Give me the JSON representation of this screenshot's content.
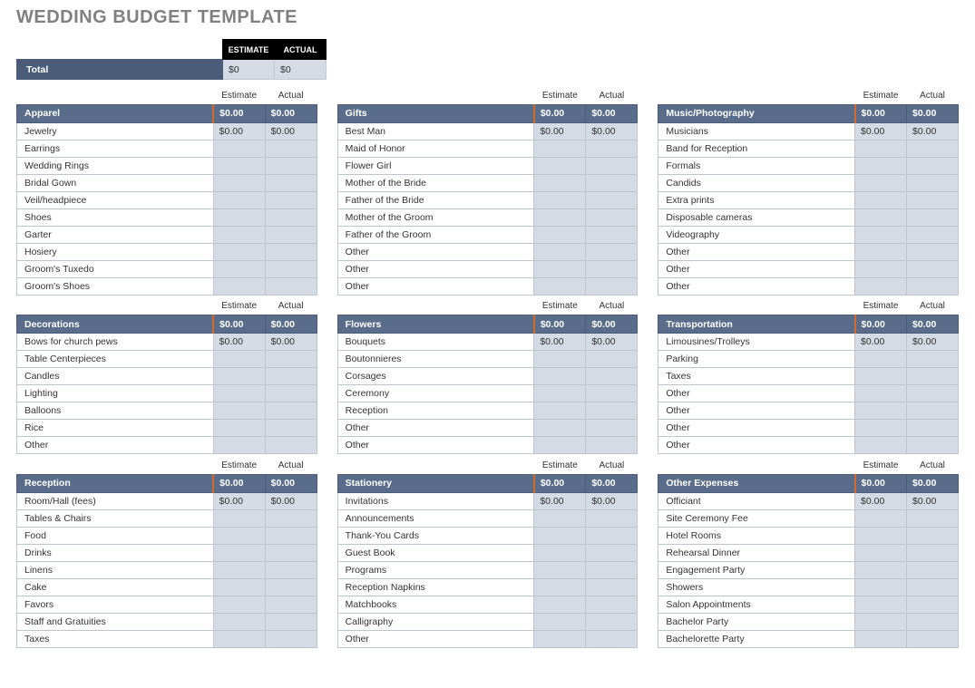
{
  "title": "WEDDING BUDGET TEMPLATE",
  "top": {
    "est_header": "ESTIMATE",
    "act_header": "ACTUAL",
    "total_label": "Total",
    "total_estimate": "$0",
    "total_actual": "$0"
  },
  "col_headers": {
    "estimate": "Estimate",
    "actual": "Actual"
  },
  "columns": [
    [
      {
        "name": "Apparel",
        "est": "$0.00",
        "act": "$0.00",
        "items": [
          {
            "label": "Jewelry",
            "est": "$0.00",
            "act": "$0.00"
          },
          {
            "label": "Earrings",
            "est": "",
            "act": ""
          },
          {
            "label": "Wedding Rings",
            "est": "",
            "act": ""
          },
          {
            "label": "Bridal Gown",
            "est": "",
            "act": ""
          },
          {
            "label": "Veil/headpiece",
            "est": "",
            "act": ""
          },
          {
            "label": "Shoes",
            "est": "",
            "act": ""
          },
          {
            "label": "Garter",
            "est": "",
            "act": ""
          },
          {
            "label": "Hosiery",
            "est": "",
            "act": ""
          },
          {
            "label": "Groom's Tuxedo",
            "est": "",
            "act": ""
          },
          {
            "label": "Groom's Shoes",
            "est": "",
            "act": ""
          }
        ]
      },
      {
        "name": "Decorations",
        "est": "$0.00",
        "act": "$0.00",
        "items": [
          {
            "label": "Bows for church pews",
            "est": "$0.00",
            "act": "$0.00"
          },
          {
            "label": "Table Centerpieces",
            "est": "",
            "act": ""
          },
          {
            "label": "Candles",
            "est": "",
            "act": ""
          },
          {
            "label": "Lighting",
            "est": "",
            "act": ""
          },
          {
            "label": "Balloons",
            "est": "",
            "act": ""
          },
          {
            "label": "Rice",
            "est": "",
            "act": ""
          },
          {
            "label": "Other",
            "est": "",
            "act": ""
          }
        ]
      },
      {
        "name": "Reception",
        "est": "$0.00",
        "act": "$0.00",
        "items": [
          {
            "label": "Room/Hall (fees)",
            "est": "$0.00",
            "act": "$0.00"
          },
          {
            "label": "Tables & Chairs",
            "est": "",
            "act": ""
          },
          {
            "label": "Food",
            "est": "",
            "act": ""
          },
          {
            "label": "Drinks",
            "est": "",
            "act": ""
          },
          {
            "label": "Linens",
            "est": "",
            "act": ""
          },
          {
            "label": "Cake",
            "est": "",
            "act": ""
          },
          {
            "label": "Favors",
            "est": "",
            "act": ""
          },
          {
            "label": "Staff and Gratuities",
            "est": "",
            "act": ""
          },
          {
            "label": "Taxes",
            "est": "",
            "act": ""
          }
        ]
      }
    ],
    [
      {
        "name": "Gifts",
        "est": "$0.00",
        "act": "$0.00",
        "items": [
          {
            "label": "Best Man",
            "est": "$0.00",
            "act": "$0.00"
          },
          {
            "label": "Maid of Honor",
            "est": "",
            "act": ""
          },
          {
            "label": "Flower Girl",
            "est": "",
            "act": ""
          },
          {
            "label": "Mother of the Bride",
            "est": "",
            "act": ""
          },
          {
            "label": "Father of the Bride",
            "est": "",
            "act": ""
          },
          {
            "label": "Mother of the Groom",
            "est": "",
            "act": ""
          },
          {
            "label": "Father of the Groom",
            "est": "",
            "act": ""
          },
          {
            "label": "Other",
            "est": "",
            "act": ""
          },
          {
            "label": "Other",
            "est": "",
            "act": ""
          },
          {
            "label": "Other",
            "est": "",
            "act": ""
          }
        ]
      },
      {
        "name": "Flowers",
        "est": "$0.00",
        "act": "$0.00",
        "items": [
          {
            "label": "Bouquets",
            "est": "$0.00",
            "act": "$0.00"
          },
          {
            "label": "Boutonnieres",
            "est": "",
            "act": ""
          },
          {
            "label": "Corsages",
            "est": "",
            "act": ""
          },
          {
            "label": "Ceremony",
            "est": "",
            "act": ""
          },
          {
            "label": "Reception",
            "est": "",
            "act": ""
          },
          {
            "label": "Other",
            "est": "",
            "act": ""
          },
          {
            "label": "Other",
            "est": "",
            "act": ""
          }
        ]
      },
      {
        "name": "Stationery",
        "est": "$0.00",
        "act": "$0.00",
        "items": [
          {
            "label": "Invitations",
            "est": "$0.00",
            "act": "$0.00"
          },
          {
            "label": "Announcements",
            "est": "",
            "act": ""
          },
          {
            "label": "Thank-You Cards",
            "est": "",
            "act": ""
          },
          {
            "label": "Guest Book",
            "est": "",
            "act": ""
          },
          {
            "label": "Programs",
            "est": "",
            "act": ""
          },
          {
            "label": "Reception Napkins",
            "est": "",
            "act": ""
          },
          {
            "label": "Matchbooks",
            "est": "",
            "act": ""
          },
          {
            "label": "Calligraphy",
            "est": "",
            "act": ""
          },
          {
            "label": "Other",
            "est": "",
            "act": ""
          }
        ]
      }
    ],
    [
      {
        "name": "Music/Photography",
        "est": "$0.00",
        "act": "$0.00",
        "items": [
          {
            "label": "Musicians",
            "est": "$0.00",
            "act": "$0.00"
          },
          {
            "label": "Band for Reception",
            "est": "",
            "act": ""
          },
          {
            "label": "Formals",
            "est": "",
            "act": ""
          },
          {
            "label": "Candids",
            "est": "",
            "act": ""
          },
          {
            "label": "Extra prints",
            "est": "",
            "act": ""
          },
          {
            "label": "Disposable cameras",
            "est": "",
            "act": ""
          },
          {
            "label": "Videography",
            "est": "",
            "act": ""
          },
          {
            "label": "Other",
            "est": "",
            "act": ""
          },
          {
            "label": "Other",
            "est": "",
            "act": ""
          },
          {
            "label": "Other",
            "est": "",
            "act": ""
          }
        ]
      },
      {
        "name": "Transportation",
        "est": "$0.00",
        "act": "$0.00",
        "items": [
          {
            "label": "Limousines/Trolleys",
            "est": "$0.00",
            "act": "$0.00"
          },
          {
            "label": "Parking",
            "est": "",
            "act": ""
          },
          {
            "label": "Taxes",
            "est": "",
            "act": ""
          },
          {
            "label": "Other",
            "est": "",
            "act": ""
          },
          {
            "label": "Other",
            "est": "",
            "act": ""
          },
          {
            "label": "Other",
            "est": "",
            "act": ""
          },
          {
            "label": "Other",
            "est": "",
            "act": ""
          }
        ]
      },
      {
        "name": "Other Expenses",
        "est": "$0.00",
        "act": "$0.00",
        "items": [
          {
            "label": "Officiant",
            "est": "$0.00",
            "act": "$0.00"
          },
          {
            "label": "Site Ceremony Fee",
            "est": "",
            "act": ""
          },
          {
            "label": "Hotel Rooms",
            "est": "",
            "act": ""
          },
          {
            "label": "Rehearsal Dinner",
            "est": "",
            "act": ""
          },
          {
            "label": "Engagement Party",
            "est": "",
            "act": ""
          },
          {
            "label": "Showers",
            "est": "",
            "act": ""
          },
          {
            "label": "Salon Appointments",
            "est": "",
            "act": ""
          },
          {
            "label": "Bachelor Party",
            "est": "",
            "act": ""
          },
          {
            "label": "Bachelorette Party",
            "est": "",
            "act": ""
          }
        ]
      }
    ]
  ]
}
